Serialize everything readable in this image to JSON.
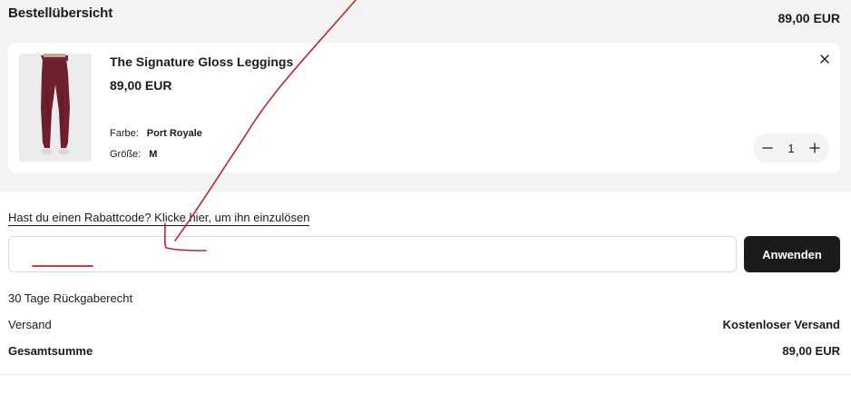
{
  "summary": {
    "title": "Bestellübersicht",
    "total": "89,00 EUR"
  },
  "item": {
    "name": "The Signature Gloss Leggings",
    "price": "89,00 EUR",
    "color_label": "Farbe:",
    "color_value": "Port Royale",
    "size_label": "Größe:",
    "size_value": "M",
    "quantity": "1",
    "image_color": "#6e1f2e"
  },
  "promo": {
    "link_text": "Hast du einen Rabattcode? Klicke hier, um ihn einzulösen",
    "input_value": "",
    "apply_label": "Anwenden"
  },
  "totals": {
    "return_policy": "30 Tage Rückgaberecht",
    "shipping_label": "Versand",
    "shipping_value": "Kostenloser Versand",
    "grand_label": "Gesamtsumme",
    "grand_value": "89,00 EUR"
  },
  "icons": {
    "remove": "close-icon",
    "decrease": "minus-icon",
    "increase": "plus-icon"
  },
  "colors": {
    "accent": "#1b1b1b",
    "band": "#f3f3f3",
    "annotation": "#c0262b"
  }
}
